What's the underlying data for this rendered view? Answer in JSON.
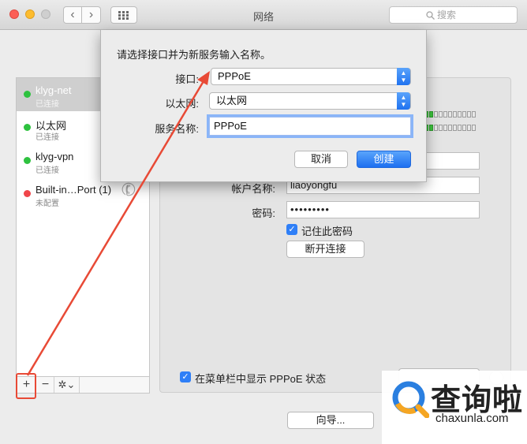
{
  "window": {
    "title": "网络"
  },
  "toolbar": {
    "back_glyph": "‹",
    "forward_glyph": "›",
    "search_placeholder": "搜索"
  },
  "services": [
    {
      "name": "klyg-net",
      "status": "已连接",
      "status_color": "#2ec23f"
    },
    {
      "name": "以太网",
      "status": "已连接",
      "status_color": "#2ec23f"
    },
    {
      "name": "klyg-vpn",
      "status": "已连接",
      "status_color": "#2ec23f"
    },
    {
      "name": "Built-in…Port (1)",
      "status": "未配置",
      "status_color": "#f0454a"
    }
  ],
  "sidebar_tools": {
    "add": "+",
    "remove": "−",
    "gear": "✲⌄"
  },
  "panel": {
    "account_label": "帐户名称:",
    "account_value": "liaoyongfu",
    "password_label": "密码:",
    "password_value": "•••••••••",
    "remember_label": "记住此密码",
    "remember_checked": true,
    "disconnect_label": "断开连接",
    "menubar_label": "在菜单栏中显示 PPPoE 状态",
    "menubar_checked": true,
    "wizard_label": "向导..."
  },
  "dialog": {
    "prompt": "请选择接口并为新服务输入名称。",
    "interface_label": "接口:",
    "interface_value": "PPPoE",
    "ethernet_label": "以太网:",
    "ethernet_value": "以太网",
    "service_label": "服务名称:",
    "service_value": "PPPoE",
    "cancel_label": "取消",
    "create_label": "创建"
  },
  "watermark": {
    "brand": "查询啦",
    "url": "chaxunla.com"
  },
  "colors": {
    "accent": "#1f72f0",
    "annotation": "#e84a36",
    "status_ok": "#2ec23f",
    "status_off": "#f0454a"
  }
}
